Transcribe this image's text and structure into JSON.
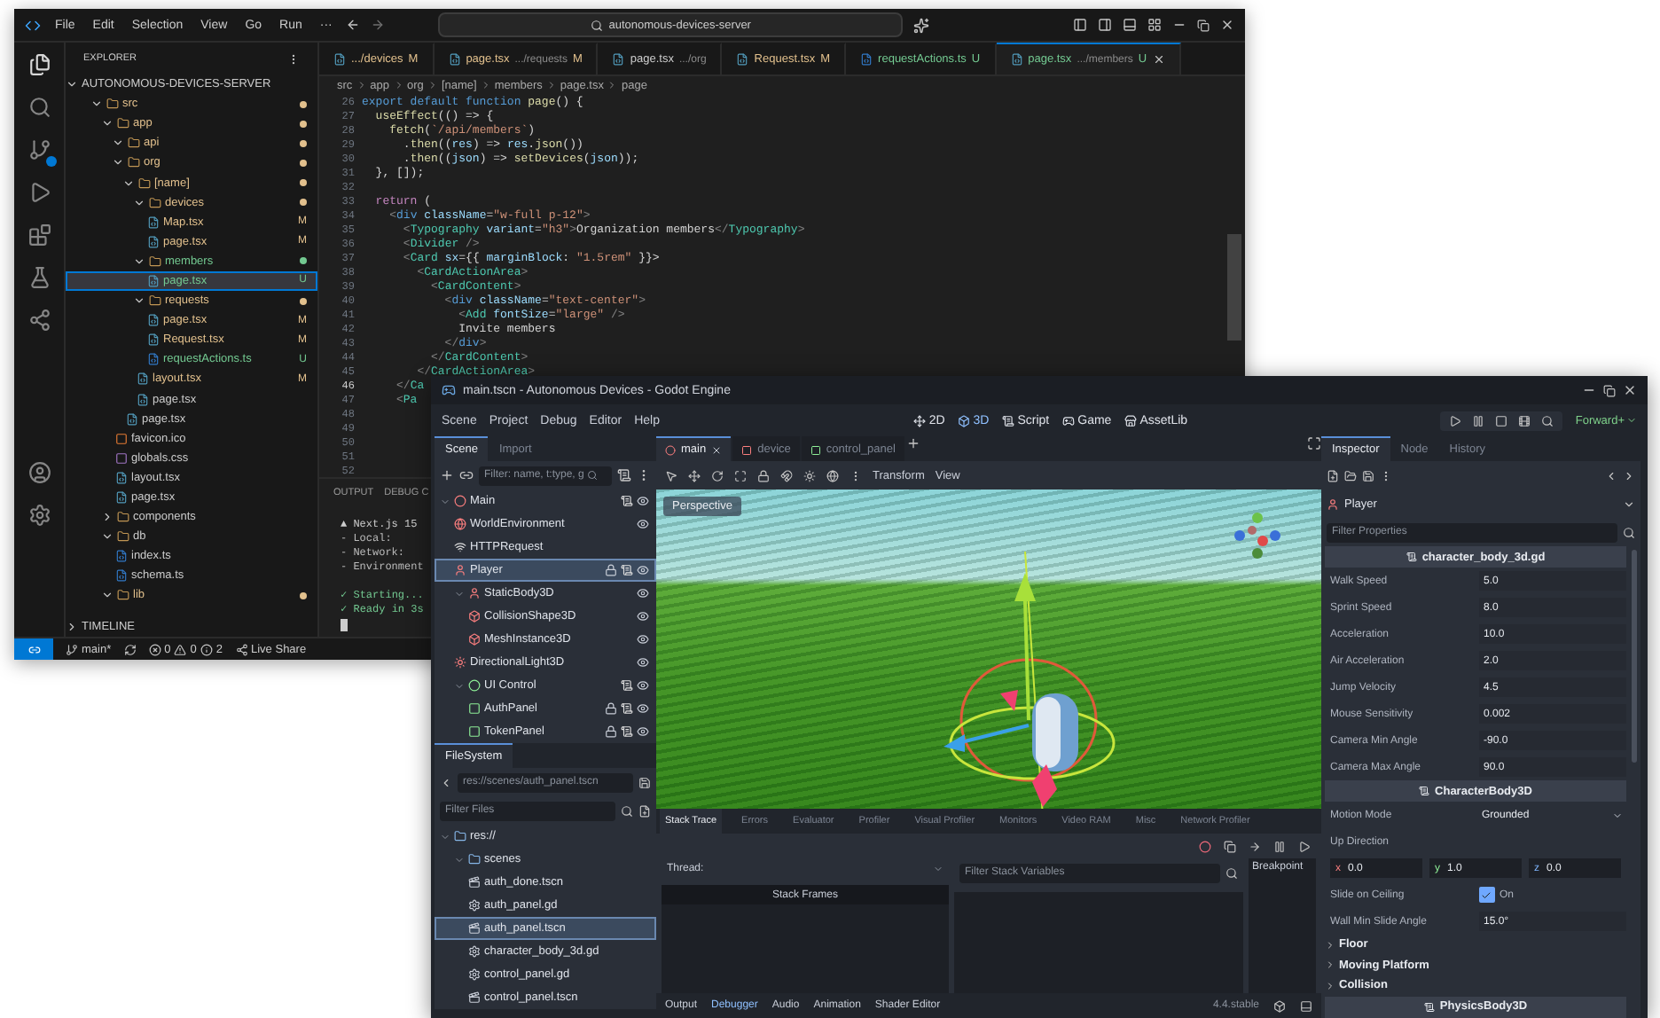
{
  "vscode": {
    "menu": [
      "File",
      "Edit",
      "Selection",
      "View",
      "Go",
      "Run",
      "···"
    ],
    "search": {
      "value": "autonomous-devices-server"
    },
    "explorer": {
      "title": "EXPLORER",
      "root": "AUTONOMOUS-DEVICES-SERVER",
      "timeline": "TIMELINE",
      "tree": [
        {
          "name": "src",
          "kind": "folder",
          "color": "#e2c08d",
          "expanded": true,
          "selected": false,
          "children": [
            {
              "name": "app",
              "kind": "folder",
              "color": "#e2c08d",
              "expanded": true,
              "selected": false,
              "children": [
                {
                  "name": "api",
                  "kind": "folder",
                  "color": "#e2c08d",
                  "expanded": true,
                  "selected": false
                },
                {
                  "name": "org",
                  "kind": "folder",
                  "color": "#e2c08d",
                  "expanded": true,
                  "selected": false,
                  "children": [
                    {
                      "name": "[name]",
                      "kind": "folder",
                      "color": "#e2c08d",
                      "expanded": true,
                      "selected": false,
                      "children": [
                        {
                          "name": "devices",
                          "kind": "folder",
                          "color": "#e2c08d",
                          "expanded": true,
                          "selected": false,
                          "children": [
                            {
                              "name": "Map.tsx",
                              "kind": "tsx",
                              "color": "#e2c08d",
                              "badge": "M",
                              "selected": false
                            },
                            {
                              "name": "page.tsx",
                              "kind": "tsx",
                              "color": "#e2c08d",
                              "badge": "M",
                              "selected": false
                            }
                          ]
                        },
                        {
                          "name": "members",
                          "kind": "folder",
                          "color": "#73c991",
                          "expanded": true,
                          "selected": false,
                          "children": [
                            {
                              "name": "page.tsx",
                              "kind": "tsx",
                              "color": "#73c991",
                              "badge": "U",
                              "selected": true
                            }
                          ]
                        },
                        {
                          "name": "requests",
                          "kind": "folder",
                          "color": "#e2c08d",
                          "expanded": true,
                          "selected": false,
                          "children": [
                            {
                              "name": "page.tsx",
                              "kind": "tsx",
                              "color": "#e2c08d",
                              "badge": "M",
                              "selected": false
                            },
                            {
                              "name": "Request.tsx",
                              "kind": "tsx",
                              "color": "#e2c08d",
                              "badge": "M",
                              "selected": false
                            },
                            {
                              "name": "requestActions.ts",
                              "kind": "ts",
                              "color": "#73c991",
                              "badge": "U",
                              "selected": false
                            }
                          ]
                        },
                        {
                          "name": "layout.tsx",
                          "kind": "tsx",
                          "color": "#e2c08d",
                          "badge": "M",
                          "selected": false
                        },
                        {
                          "name": "page.tsx",
                          "kind": "tsx",
                          "selected": false
                        }
                      ]
                    },
                    {
                      "name": "page.tsx",
                      "kind": "tsx",
                      "selected": false
                    }
                  ]
                },
                {
                  "name": "favicon.ico",
                  "kind": "ico",
                  "selected": false
                },
                {
                  "name": "globals.css",
                  "kind": "css",
                  "selected": false
                },
                {
                  "name": "layout.tsx",
                  "kind": "tsx",
                  "selected": false
                },
                {
                  "name": "page.tsx",
                  "kind": "tsx",
                  "selected": false
                }
              ]
            },
            {
              "name": "components",
              "kind": "folder",
              "expanded": false,
              "selected": false
            },
            {
              "name": "db",
              "kind": "folder",
              "expanded": true,
              "selected": false,
              "children": [
                {
                  "name": "index.ts",
                  "kind": "ts",
                  "selected": false
                },
                {
                  "name": "schema.ts",
                  "kind": "ts",
                  "selected": false
                }
              ]
            },
            {
              "name": "lib",
              "kind": "folder",
              "color": "#e2c08d",
              "expanded": true,
              "selected": false
            }
          ]
        }
      ]
    },
    "tabs": [
      {
        "label": ".../devices",
        "badge": "M",
        "kind": "tsx",
        "color": "#e2c08d",
        "selected": false
      },
      {
        "label": "page.tsx",
        "detail": ".../requests",
        "badge": "M",
        "kind": "tsx",
        "color": "#e2c08d",
        "selected": false
      },
      {
        "label": "page.tsx",
        "detail": ".../org",
        "kind": "tsx",
        "selected": false
      },
      {
        "label": "Request.tsx",
        "badge": "M",
        "kind": "tsx",
        "color": "#e2c08d",
        "selected": false
      },
      {
        "label": "requestActions.ts",
        "badge": "U",
        "kind": "ts",
        "color": "#73c991",
        "selected": false
      },
      {
        "label": "page.tsx",
        "detail": ".../members",
        "badge": "U",
        "kind": "tsx",
        "color": "#73c991",
        "selected": true
      }
    ],
    "breadcrumbs": [
      "src",
      "app",
      "org",
      "[name]",
      "members",
      "page.tsx",
      "page"
    ],
    "code": [
      {
        "n": "26",
        "segs": [
          {
            "text": "export default function ",
            "kind": "kw"
          },
          {
            "text": "page",
            "kind": "fn"
          },
          {
            "text": "() {",
            "kind": "plain"
          }
        ]
      },
      {
        "n": "27",
        "segs": [
          {
            "text": "  useEffect",
            "kind": "fn"
          },
          {
            "text": "(() => {",
            "kind": "plain"
          }
        ]
      },
      {
        "n": "28",
        "segs": [
          {
            "text": "    fetch",
            "kind": "fn"
          },
          {
            "text": "(",
            "kind": "plain"
          },
          {
            "text": "`/api/members`",
            "kind": "str"
          },
          {
            "text": ")",
            "kind": "plain"
          }
        ]
      },
      {
        "n": "29",
        "segs": [
          {
            "text": "      .",
            "kind": "plain"
          },
          {
            "text": "then",
            "kind": "fn"
          },
          {
            "text": "((",
            "kind": "plain"
          },
          {
            "text": "res",
            "kind": "attr"
          },
          {
            "text": ") => ",
            "kind": "plain"
          },
          {
            "text": "res",
            "kind": "attr"
          },
          {
            "text": ".",
            "kind": "plain"
          },
          {
            "text": "json",
            "kind": "fn"
          },
          {
            "text": "())",
            "kind": "plain"
          }
        ]
      },
      {
        "n": "30",
        "segs": [
          {
            "text": "      .",
            "kind": "plain"
          },
          {
            "text": "then",
            "kind": "fn"
          },
          {
            "text": "((",
            "kind": "plain"
          },
          {
            "text": "json",
            "kind": "attr"
          },
          {
            "text": ") => ",
            "kind": "plain"
          },
          {
            "text": "setDevices",
            "kind": "fn"
          },
          {
            "text": "(",
            "kind": "plain"
          },
          {
            "text": "json",
            "kind": "attr"
          },
          {
            "text": "));",
            "kind": "plain"
          }
        ]
      },
      {
        "n": "31",
        "segs": [
          {
            "text": "  }, []);",
            "kind": "plain"
          }
        ]
      },
      {
        "n": "32"
      },
      {
        "n": "33",
        "segs": [
          {
            "text": "  return",
            "kind": "ctrl"
          },
          {
            "text": " (",
            "kind": "plain"
          }
        ]
      },
      {
        "n": "34",
        "segs": [
          {
            "text": "    <",
            "kind": "punct"
          },
          {
            "text": "div ",
            "kind": "kw"
          },
          {
            "text": "className",
            "kind": "attr"
          },
          {
            "text": "=",
            "kind": "plain"
          },
          {
            "text": "\"w-full p-12\"",
            "kind": "str"
          },
          {
            "text": ">",
            "kind": "punct"
          }
        ]
      },
      {
        "n": "35",
        "segs": [
          {
            "text": "      <",
            "kind": "punct"
          },
          {
            "text": "Typography ",
            "kind": "tag"
          },
          {
            "text": "variant",
            "kind": "attr"
          },
          {
            "text": "=",
            "kind": "plain"
          },
          {
            "text": "\"h3\"",
            "kind": "str"
          },
          {
            "text": ">",
            "kind": "punct"
          },
          {
            "text": "Organization members",
            "kind": "plain"
          },
          {
            "text": "</",
            "kind": "punct"
          },
          {
            "text": "Typography",
            "kind": "tag"
          },
          {
            "text": ">",
            "kind": "punct"
          }
        ]
      },
      {
        "n": "36",
        "segs": [
          {
            "text": "      <",
            "kind": "punct"
          },
          {
            "text": "Divider",
            "kind": "tag"
          },
          {
            "text": " />",
            "kind": "punct"
          }
        ]
      },
      {
        "n": "37",
        "segs": [
          {
            "text": "      <",
            "kind": "punct"
          },
          {
            "text": "Card ",
            "kind": "tag"
          },
          {
            "text": "sx",
            "kind": "attr"
          },
          {
            "text": "={{ ",
            "kind": "plain"
          },
          {
            "text": "marginBlock",
            "kind": "attr"
          },
          {
            "text": ": ",
            "kind": "plain"
          },
          {
            "text": "\"1.5rem\"",
            "kind": "str"
          },
          {
            "text": " }}>",
            "kind": "plain"
          }
        ]
      },
      {
        "n": "38",
        "segs": [
          {
            "text": "        <",
            "kind": "punct"
          },
          {
            "text": "CardActionArea",
            "kind": "tag"
          },
          {
            "text": ">",
            "kind": "punct"
          }
        ]
      },
      {
        "n": "39",
        "segs": [
          {
            "text": "          <",
            "kind": "punct"
          },
          {
            "text": "CardContent",
            "kind": "tag"
          },
          {
            "text": ">",
            "kind": "punct"
          }
        ]
      },
      {
        "n": "40",
        "segs": [
          {
            "text": "            <",
            "kind": "punct"
          },
          {
            "text": "div ",
            "kind": "kw"
          },
          {
            "text": "className",
            "kind": "attr"
          },
          {
            "text": "=",
            "kind": "plain"
          },
          {
            "text": "\"text-center\"",
            "kind": "str"
          },
          {
            "text": ">",
            "kind": "punct"
          }
        ]
      },
      {
        "n": "41",
        "segs": [
          {
            "text": "              <",
            "kind": "punct"
          },
          {
            "text": "Add ",
            "kind": "tag"
          },
          {
            "text": "fontSize",
            "kind": "attr"
          },
          {
            "text": "=",
            "kind": "plain"
          },
          {
            "text": "\"large\"",
            "kind": "str"
          },
          {
            "text": " />",
            "kind": "punct"
          }
        ]
      },
      {
        "n": "42",
        "segs": [
          {
            "text": "              Invite members",
            "kind": "plain"
          }
        ]
      },
      {
        "n": "43",
        "segs": [
          {
            "text": "            </",
            "kind": "punct"
          },
          {
            "text": "div",
            "kind": "kw"
          },
          {
            "text": ">",
            "kind": "punct"
          }
        ]
      },
      {
        "n": "44",
        "segs": [
          {
            "text": "          </",
            "kind": "punct"
          },
          {
            "text": "CardContent",
            "kind": "tag"
          },
          {
            "text": ">",
            "kind": "punct"
          }
        ]
      },
      {
        "n": "45",
        "segs": [
          {
            "text": "        </",
            "kind": "punct"
          },
          {
            "text": "CardActionArea",
            "kind": "tag"
          },
          {
            "text": ">",
            "kind": "punct"
          }
        ]
      },
      {
        "n": "46",
        "segs": [
          {
            "text": "     </",
            "kind": "punct"
          },
          {
            "text": "Ca",
            "kind": "tag"
          }
        ]
      },
      {
        "n": "47",
        "segs": [
          {
            "text": "     <",
            "kind": "punct"
          },
          {
            "text": "Pa",
            "kind": "tag"
          }
        ]
      },
      {
        "n": "48"
      },
      {
        "n": "49"
      },
      {
        "n": "50"
      },
      {
        "n": "51"
      },
      {
        "n": "52"
      }
    ],
    "panel": {
      "tabs": [
        "OUTPUT",
        "DEBUG C"
      ],
      "lines": [
        {
          "kind": "info",
          "text": "▲ Next.js 15"
        },
        {
          "kind": "plain",
          "text": "- Local:"
        },
        {
          "kind": "plain",
          "text": "- Network:"
        },
        {
          "kind": "plain",
          "text": "- Environment"
        },
        {
          "kind": "ok",
          "text": "✓ Starting..."
        },
        {
          "kind": "ok",
          "text": "✓ Ready in 3s"
        }
      ]
    },
    "status_bar": {
      "branch": "main*",
      "errors": "0",
      "warnings": "0",
      "info": "2",
      "live_share": "Live Share"
    }
  },
  "godot": {
    "title": "main.tscn - Autonomous Devices - Godot Engine",
    "menu": [
      "Scene",
      "Project",
      "Debug",
      "Editor",
      "Help"
    ],
    "workspaces": [
      {
        "label": "2D",
        "kind": "flat",
        "selected": false
      },
      {
        "label": "3D",
        "kind": "spatial",
        "selected": true
      },
      {
        "label": "Script",
        "kind": "script",
        "selected": false
      },
      {
        "label": "Game",
        "kind": "game",
        "selected": false
      },
      {
        "label": "AssetLib",
        "kind": "assetlib",
        "selected": false
      }
    ],
    "renderer": "Forward+",
    "scene_dock": {
      "tabs": [
        {
          "label": "Scene",
          "selected": true
        },
        {
          "label": "Import",
          "selected": false
        }
      ],
      "filter": {
        "placeholder": "Filter: name, t:type, g"
      },
      "tree": [
        {
          "name": "Main",
          "kind": "node3d",
          "script": true,
          "locked": false,
          "visible": true,
          "expanded": true,
          "selected": false,
          "children": [
            {
              "name": "WorldEnvironment",
              "kind": "world",
              "script": false,
              "locked": false,
              "visible": true,
              "selected": false
            },
            {
              "name": "HTTPRequest",
              "kind": "node",
              "script": false,
              "locked": false,
              "selected": false
            },
            {
              "name": "Player",
              "kind": "body",
              "script": true,
              "locked": true,
              "visible": true,
              "selected": true
            },
            {
              "name": "StaticBody3D",
              "kind": "body",
              "script": false,
              "locked": false,
              "visible": true,
              "expanded": true,
              "selected": false,
              "children": [
                {
                  "name": "CollisionShape3D",
                  "kind": "shape",
                  "script": false,
                  "locked": false,
                  "visible": true,
                  "selected": false
                },
                {
                  "name": "MeshInstance3D",
                  "kind": "mesh",
                  "script": false,
                  "locked": false,
                  "visible": true,
                  "selected": false
                }
              ]
            },
            {
              "name": "DirectionalLight3D",
              "kind": "light",
              "script": false,
              "locked": false,
              "visible": true,
              "selected": false
            },
            {
              "name": "UI Control",
              "kind": "control",
              "script": true,
              "locked": false,
              "visible": true,
              "expanded": true,
              "selected": false,
              "children": [
                {
                  "name": "AuthPanel",
                  "kind": "panel",
                  "script": true,
                  "locked": true,
                  "visible": true,
                  "selected": false
                },
                {
                  "name": "TokenPanel",
                  "kind": "panel",
                  "script": true,
                  "locked": true,
                  "visible": true,
                  "selected": false
                }
              ]
            }
          ]
        }
      ]
    },
    "filesystem": {
      "tab": "FileSystem",
      "path": "res://scenes/auth_panel.tscn",
      "filter": {
        "placeholder": "Filter Files"
      },
      "tree": [
        {
          "name": "res://",
          "kind": "folder",
          "expanded": true,
          "selected": false,
          "children": [
            {
              "name": "scenes",
              "kind": "folder",
              "expanded": true,
              "selected": false,
              "children": [
                {
                  "name": "auth_done.tscn",
                  "kind": "scene",
                  "selected": false
                },
                {
                  "name": "auth_panel.gd",
                  "kind": "script",
                  "selected": false
                },
                {
                  "name": "auth_panel.tscn",
                  "kind": "scene",
                  "selected": true
                },
                {
                  "name": "character_body_3d.gd",
                  "kind": "script",
                  "selected": false
                },
                {
                  "name": "control_panel.gd",
                  "kind": "script",
                  "selected": false
                },
                {
                  "name": "control_panel.tscn",
                  "kind": "scene",
                  "selected": false
                }
              ]
            }
          ]
        }
      ]
    },
    "scene_tabs": [
      {
        "label": "main",
        "kind": "spatial",
        "selected": true
      },
      {
        "label": "device",
        "kind": "flat",
        "selected": false
      },
      {
        "label": "control_panel",
        "kind": "control",
        "selected": false
      }
    ],
    "viewport": {
      "menus": [
        "Transform",
        "View"
      ],
      "camera": "Perspective"
    },
    "debugger": {
      "tabs": [
        {
          "label": "Stack Trace",
          "selected": true
        },
        {
          "label": "Errors",
          "selected": false
        },
        {
          "label": "Evaluator",
          "selected": false
        },
        {
          "label": "Profiler",
          "selected": false
        },
        {
          "label": "Visual Profiler",
          "selected": false
        },
        {
          "label": "Monitors",
          "selected": false
        },
        {
          "label": "Video RAM",
          "selected": false
        },
        {
          "label": "Misc",
          "selected": false
        },
        {
          "label": "Network Profiler",
          "selected": false
        }
      ],
      "thread": "Thread:",
      "filter": {
        "placeholder": "Filter Stack Variables"
      },
      "frames": "Stack Frames",
      "breakpoints": "Breakpoint"
    },
    "bottom_tabs": [
      {
        "label": "Output",
        "selected": false
      },
      {
        "label": "Debugger",
        "selected": true
      },
      {
        "label": "Audio",
        "selected": false
      },
      {
        "label": "Animation",
        "selected": false
      },
      {
        "label": "Shader Editor",
        "selected": false
      }
    ],
    "version": "4.4.stable",
    "inspector": {
      "tabs": [
        {
          "label": "Inspector",
          "selected": true
        },
        {
          "label": "Node",
          "selected": false
        },
        {
          "label": "History",
          "selected": false
        }
      ],
      "node": "Player",
      "filter": {
        "placeholder": "Filter Properties"
      },
      "rows": [
        {
          "kind": "header",
          "label": "character_body_3d.gd"
        },
        {
          "kind": "value",
          "label": "Walk Speed",
          "value": "5.0"
        },
        {
          "kind": "value",
          "label": "Sprint Speed",
          "value": "8.0"
        },
        {
          "kind": "value",
          "label": "Acceleration",
          "value": "10.0"
        },
        {
          "kind": "value",
          "label": "Air Acceleration",
          "value": "2.0"
        },
        {
          "kind": "value",
          "label": "Jump Velocity",
          "value": "4.5"
        },
        {
          "kind": "value",
          "label": "Mouse Sensitivity",
          "value": "0.002"
        },
        {
          "kind": "value",
          "label": "Camera Min Angle",
          "value": "-90.0"
        },
        {
          "kind": "value",
          "label": "Camera Max Angle",
          "value": "90.0"
        },
        {
          "kind": "header",
          "label": "CharacterBody3D"
        },
        {
          "kind": "dropdown",
          "label": "Motion Mode",
          "value": "Grounded"
        },
        {
          "kind": "label",
          "label": "Up Direction"
        },
        {
          "kind": "vector",
          "values": [
            {
              "axis": "x",
              "value": "0.0"
            },
            {
              "axis": "y",
              "value": "1.0"
            },
            {
              "axis": "z",
              "value": "0.0"
            }
          ]
        },
        {
          "kind": "check",
          "label": "Slide on Ceiling",
          "checked": true,
          "value": "On"
        },
        {
          "kind": "value",
          "label": "Wall Min Slide Angle",
          "value": "15.0°"
        },
        {
          "kind": "section",
          "label": "Floor",
          "expanded": false
        },
        {
          "kind": "section",
          "label": "Moving Platform",
          "expanded": false
        },
        {
          "kind": "section",
          "label": "Collision",
          "expanded": false
        },
        {
          "kind": "header",
          "label": "PhysicsBody3D"
        }
      ]
    }
  }
}
